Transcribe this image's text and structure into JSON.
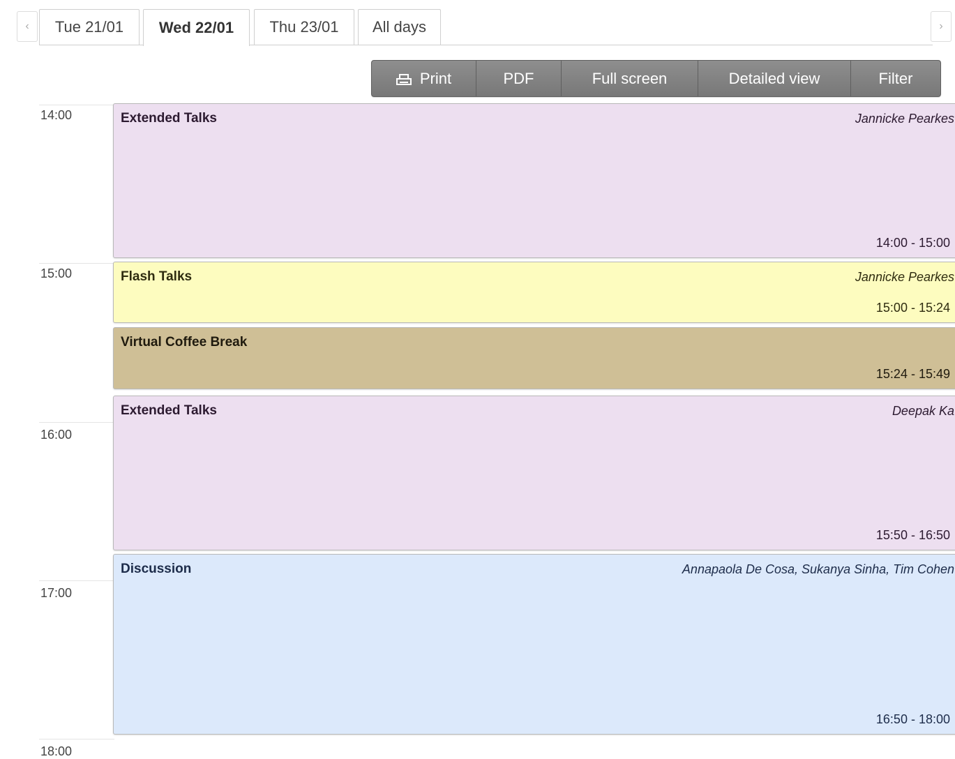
{
  "nav": {
    "prev_icon": "chevron-left-icon",
    "next_icon": "chevron-right-icon"
  },
  "tabs": [
    {
      "label": "Tue 21/01",
      "active": false
    },
    {
      "label": "Wed 22/01",
      "active": true
    },
    {
      "label": "Thu 23/01",
      "active": false
    },
    {
      "label": "All days",
      "active": false
    }
  ],
  "toolbar": {
    "print_label": "Print",
    "pdf_label": "PDF",
    "fullscreen_label": "Full screen",
    "detailed_label": "Detailed view",
    "filter_label": "Filter"
  },
  "hours": [
    "14:00",
    "15:00",
    "16:00",
    "17:00",
    "18:00"
  ],
  "entries": [
    {
      "title": "Extended Talks",
      "people": "Jannicke Pearkes",
      "time": "14:00 - 15:00",
      "color": "#eddff0",
      "text_color": "#2c1a30"
    },
    {
      "title": "Flash Talks",
      "people": "Jannicke Pearkes",
      "time": "15:00 - 15:24",
      "color": "#fdfcbf",
      "text_color": "#2f2c10"
    },
    {
      "title": "Virtual Coffee Break",
      "people": "",
      "time": "15:24 - 15:49",
      "color": "#cfbf96",
      "text_color": "#1f1a0e"
    },
    {
      "title": "Extended Talks",
      "people": "Deepak Ka",
      "time": "15:50 - 16:50",
      "color": "#eddff0",
      "text_color": "#2c1a30"
    },
    {
      "title": "Discussion",
      "people": "Annapaola De Cosa, Sukanya Sinha, Tim Cohen",
      "time": "16:50 - 18:00",
      "color": "#dce9fb",
      "text_color": "#1d2c4a"
    }
  ]
}
